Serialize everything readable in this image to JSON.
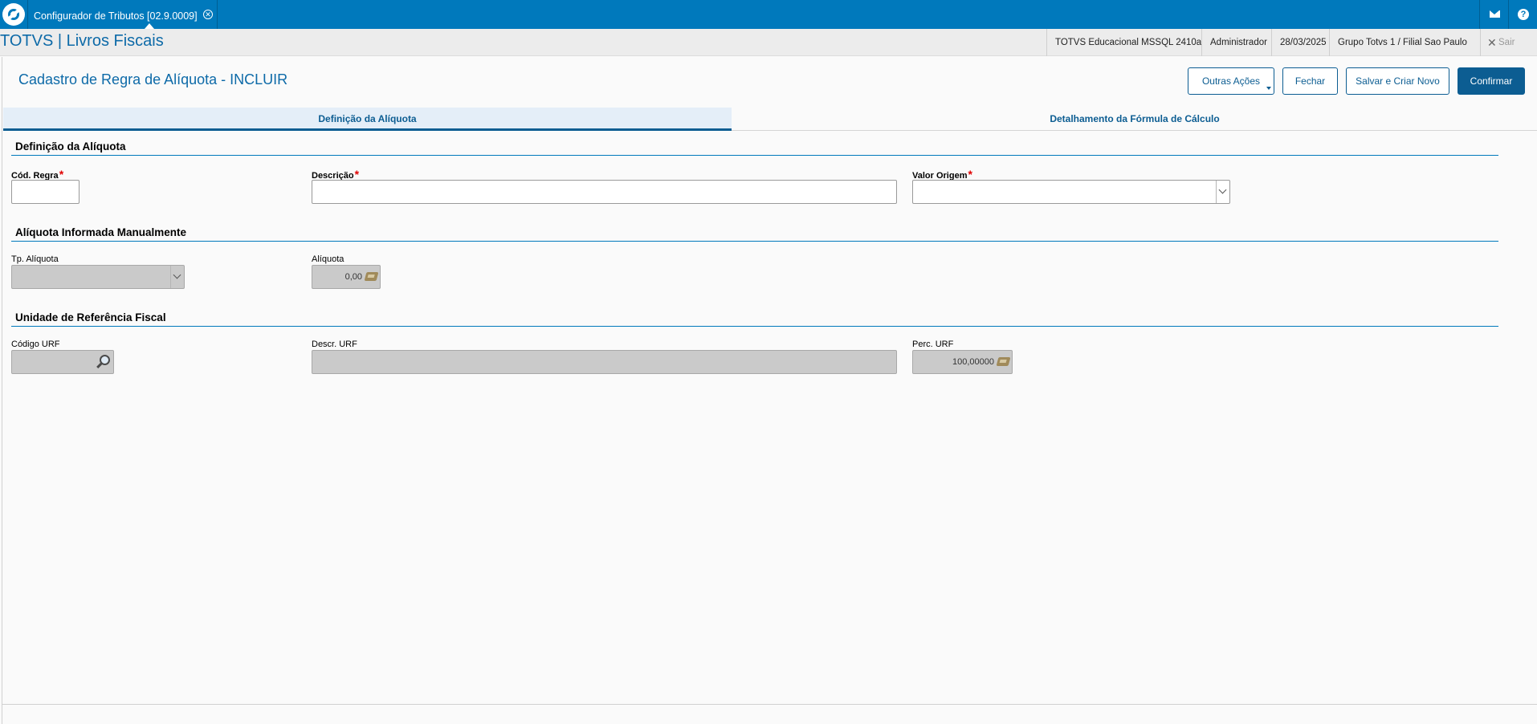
{
  "topbar": {
    "tab_title": "Configurador de Tributos [02.9.0009]",
    "tab_close_icon": "✕"
  },
  "header": {
    "app_title": "TOTVS | Livros Fiscais",
    "environment": "TOTVS Educacional MSSQL 2410a",
    "user": "Administrador",
    "date": "28/03/2025",
    "branch": "Grupo Totvs 1 / Filial Sao Paulo",
    "exit_label": "Sair"
  },
  "page": {
    "title": "Cadastro de Regra de Alíquota - INCLUIR"
  },
  "actions": {
    "more_label": "Outras Ações",
    "close_label": "Fechar",
    "save_new_label": "Salvar e Criar Novo",
    "confirm_label": "Confirmar"
  },
  "tabs": [
    {
      "label": "Definição da Alíquota",
      "active": true
    },
    {
      "label": "Detalhamento da Fórmula de Cálculo",
      "active": false
    }
  ],
  "sections": {
    "definicao": {
      "title": "Definição da Alíquota",
      "cod_regra_label": "Cód. Regra",
      "cod_regra_value": "",
      "descricao_label": "Descrição",
      "descricao_value": "",
      "valor_origem_label": "Valor Origem",
      "valor_origem_value": ""
    },
    "manual": {
      "title": "Alíquota Informada Manualmente",
      "tp_aliquota_label": "Tp. Alíquota",
      "tp_aliquota_value": "",
      "aliquota_label": "Alíquota",
      "aliquota_value": "0,00"
    },
    "urf": {
      "title": "Unidade de Referência Fiscal",
      "codigo_label": "Código URF",
      "codigo_value": "",
      "descr_label": "Descr. URF",
      "descr_value": "",
      "perc_label": "Perc. URF",
      "perc_value": "100,00000"
    }
  },
  "required_marker": "*",
  "colors": {
    "brand": "#0079bc",
    "accent": "#0c5d92",
    "required": "#e00000"
  },
  "icons": {
    "logo": "totvs-logo-icon",
    "mail": "mail-icon",
    "help": "help-icon",
    "exit": "close-icon",
    "calculator": "calculator-icon",
    "search": "search-icon",
    "dropdown": "chevron-down-icon"
  }
}
